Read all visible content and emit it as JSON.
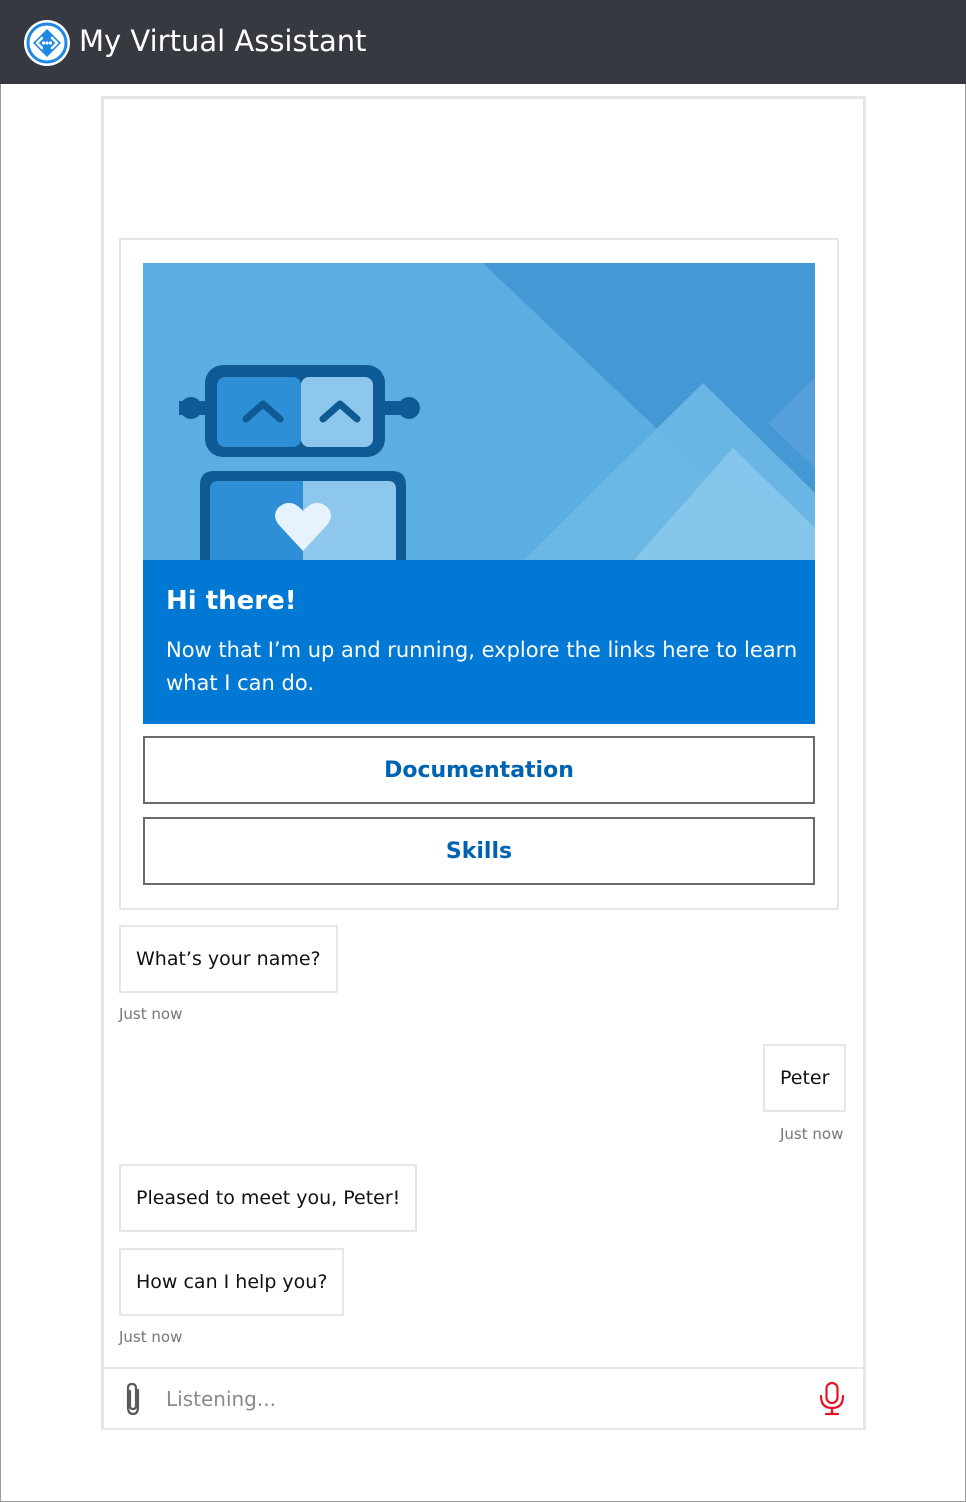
{
  "app": {
    "title": "My Virtual Assistant",
    "icon": "bot-logo-icon"
  },
  "card": {
    "hero_image": "robot-illustration",
    "title": "Hi there!",
    "body": "Now that I’m up and running, explore the links here to learn what I can do.",
    "buttons": [
      {
        "label": "Documentation"
      },
      {
        "label": "Skills"
      }
    ]
  },
  "messages": [
    {
      "from": "bot",
      "text": "What’s your name?",
      "timestamp": "Just now"
    },
    {
      "from": "user",
      "text": "Peter",
      "timestamp": "Just now"
    },
    {
      "from": "bot",
      "text": "Pleased to meet you, Peter!"
    },
    {
      "from": "bot",
      "text": "How can I help you?",
      "timestamp": "Just now"
    }
  ],
  "input": {
    "placeholder": "Listening...",
    "attach_icon": "paperclip-icon",
    "mic_icon": "microphone-icon"
  },
  "colors": {
    "header_bg": "#363a40",
    "card_panel": "#0078d4",
    "button_text": "#0063b1",
    "mic_active": "#e81123"
  }
}
